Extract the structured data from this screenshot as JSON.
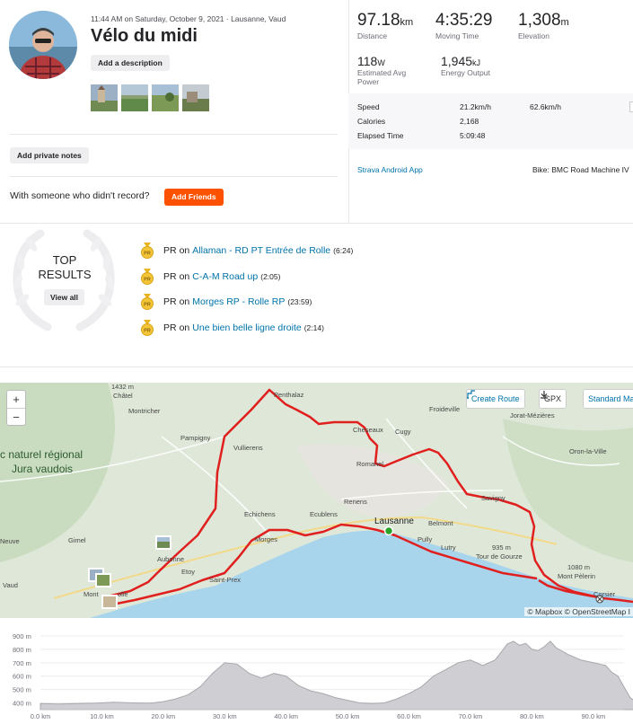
{
  "activity": {
    "meta_line": "11:44 AM on Saturday, October 9, 2021 · Lausanne, Vaud",
    "title": "Vélo du midi",
    "add_description": "Add a description",
    "add_private_notes": "Add private notes",
    "with_someone": "With someone who didn't record?",
    "add_friends": "Add Friends"
  },
  "stats": {
    "distance": {
      "value": "97.18",
      "unit": "km",
      "label": "Distance"
    },
    "moving_time": {
      "value": "4:35:29",
      "label": "Moving Time"
    },
    "elevation": {
      "value": "1,308",
      "unit": "m",
      "label": "Elevation"
    },
    "power": {
      "value": "118",
      "unit": "W",
      "label": "Estimated Avg Power"
    },
    "energy": {
      "value": "1,945",
      "unit": "kJ",
      "label": "Energy Output"
    },
    "rows": [
      {
        "label": "Speed",
        "v1": "21.2km/h",
        "v2": "62.6km/h"
      },
      {
        "label": "Calories",
        "v1": "2,168",
        "v2": ""
      },
      {
        "label": "Elapsed Time",
        "v1": "5:09:48",
        "v2": ""
      }
    ],
    "device": "Strava Android App",
    "bike": "Bike: BMC Road Machine IV"
  },
  "top_results": {
    "title_line1": "TOP",
    "title_line2": "RESULTS",
    "view_all": "View all",
    "pr_label": "PR",
    "on_label": "on",
    "items": [
      {
        "segment": "Allaman - RD PT Entrée de Rolle",
        "time": "(6:24)"
      },
      {
        "segment": "C-A-M Road up",
        "time": "(2:05)"
      },
      {
        "segment": "Morges RP - Rolle RP",
        "time": "(23:59)"
      },
      {
        "segment": "Une bien belle ligne droite",
        "time": "(2:14)"
      }
    ]
  },
  "map": {
    "zoom_in": "+",
    "zoom_out": "−",
    "create_route": "Create Route",
    "gpx": "GPX",
    "map_style": "Standard Ma",
    "attribution": "© Mapbox © OpenStreetMap I",
    "labels": {
      "chatel_alt": "1432 m",
      "chatel": "Châtel",
      "montricher": "Montricher",
      "pampigny": "Pampigny",
      "vullierens": "Vullierens",
      "penthalaz": "Penthalaz",
      "cheseaux": "Cheseaux",
      "cugy": "Cugy",
      "froideville": "Froideville",
      "jorat": "Jorat-Mézières",
      "oron": "Oron-la-Ville",
      "romanel": "Romanel",
      "parc1": "c naturel régional",
      "parc2": "Jura vaudois",
      "renens": "Renens",
      "lausanne": "Lausanne",
      "echichens": "Echichens",
      "ecublens": "Ecublens",
      "belmont": "Belmont",
      "savigny": "Savigny",
      "gimel": "Gimel",
      "neuve": "Neuve",
      "morges": "Morges",
      "pully": "Pully",
      "lutry": "Lutry",
      "alt935": "935 m",
      "gourze": "Tour de Gourze",
      "aubonne": "Aubonne",
      "etoy": "Etoy",
      "alt1080": "1080 m",
      "pelerin": "Mont Pèlerin",
      "vaud": "Vaud",
      "stprex": "Saint-Prex",
      "mont": "Mont",
      "rolle": "olle",
      "corsier": "Corsier"
    }
  },
  "elevation_chart": {
    "y_ticks": [
      "900 m",
      "800 m",
      "700 m",
      "600 m",
      "500 m",
      "400 m"
    ],
    "x_ticks": [
      "0.0 km",
      "10.0 km",
      "20.0 km",
      "30.0 km",
      "40.0 km",
      "50.0 km",
      "60.0 km",
      "70.0 km",
      "80.0 km",
      "90.0 km"
    ],
    "profile": [
      [
        0,
        395
      ],
      [
        3,
        392
      ],
      [
        6,
        395
      ],
      [
        9,
        398
      ],
      [
        12,
        405
      ],
      [
        15,
        400
      ],
      [
        18,
        398
      ],
      [
        20,
        410
      ],
      [
        22,
        430
      ],
      [
        24,
        460
      ],
      [
        26,
        520
      ],
      [
        28,
        620
      ],
      [
        30,
        700
      ],
      [
        32,
        690
      ],
      [
        34,
        620
      ],
      [
        36,
        585
      ],
      [
        38,
        620
      ],
      [
        40,
        600
      ],
      [
        42,
        530
      ],
      [
        44,
        490
      ],
      [
        46,
        470
      ],
      [
        48,
        440
      ],
      [
        50,
        420
      ],
      [
        52,
        400
      ],
      [
        54,
        395
      ],
      [
        56,
        400
      ],
      [
        58,
        430
      ],
      [
        60,
        470
      ],
      [
        62,
        520
      ],
      [
        64,
        600
      ],
      [
        66,
        650
      ],
      [
        68,
        700
      ],
      [
        70,
        720
      ],
      [
        72,
        680
      ],
      [
        74,
        720
      ],
      [
        75,
        780
      ],
      [
        76,
        840
      ],
      [
        77,
        860
      ],
      [
        78,
        830
      ],
      [
        79,
        845
      ],
      [
        80,
        800
      ],
      [
        81,
        790
      ],
      [
        82,
        820
      ],
      [
        83,
        860
      ],
      [
        84,
        810
      ],
      [
        86,
        760
      ],
      [
        88,
        720
      ],
      [
        90,
        700
      ],
      [
        92,
        680
      ],
      [
        93,
        630
      ],
      [
        94,
        600
      ],
      [
        95,
        520
      ],
      [
        96,
        440
      ],
      [
        97.2,
        400
      ]
    ],
    "colors": {
      "fill": "#cfcfd3",
      "line": "#a8a8ad"
    }
  },
  "colors": {
    "accent": "#fc5200",
    "link": "#0073a8",
    "route": "#e01f1f",
    "lake": "#a9d5ec"
  }
}
